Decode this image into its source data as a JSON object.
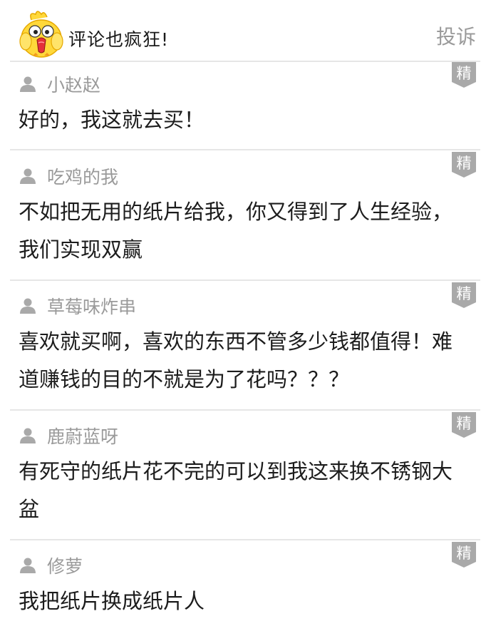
{
  "header": {
    "title": "评论也疯狂!",
    "report_label": "投诉",
    "mascot_icon": "chick-mascot-icon"
  },
  "badge_label": "精",
  "colors": {
    "author": "#9a9a9a",
    "badge": "#a9a9a9",
    "divider": "#e6e6e6",
    "text": "#1c1c1c"
  },
  "comments": [
    {
      "author": "小赵赵",
      "text": "好的，我这就去买！"
    },
    {
      "author": "吃鸡的我",
      "text": "不如把无用的纸片给我，你又得到了人生经验，我们实现双赢"
    },
    {
      "author": "草莓味炸串",
      "text": "喜欢就买啊，喜欢的东西不管多少钱都值得！难道赚钱的目的不就是为了花吗？？？"
    },
    {
      "author": "鹿蔚蓝呀",
      "text": "有死守的纸片花不完的可以到我这来换不锈钢大盆"
    },
    {
      "author": "修萝",
      "text": "我把纸片换成纸片人"
    }
  ]
}
